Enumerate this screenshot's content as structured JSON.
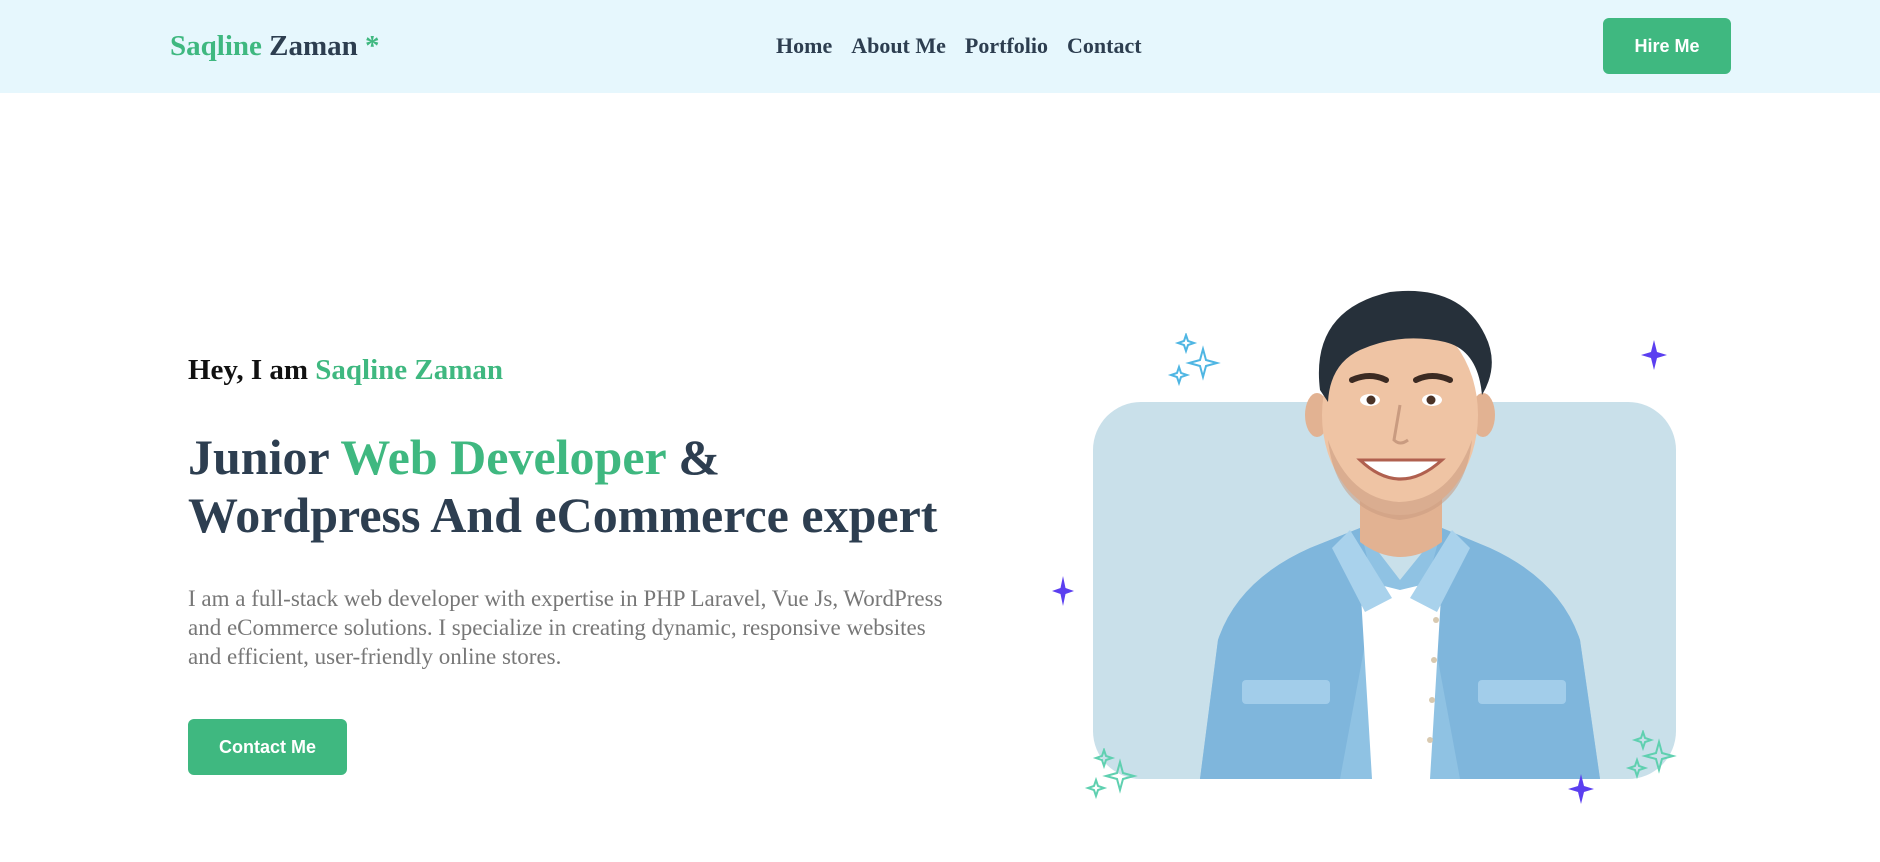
{
  "header": {
    "logo": {
      "first": "Saqline",
      "last": "Zaman",
      "mark": "*"
    },
    "nav": [
      {
        "label": "Home"
      },
      {
        "label": "About Me"
      },
      {
        "label": "Portfolio"
      },
      {
        "label": "Contact"
      }
    ],
    "cta_label": "Hire Me"
  },
  "hero": {
    "greeting_prefix": "Hey, I am",
    "greeting_name": "Saqline Zaman",
    "headline": {
      "part1": "Junior",
      "accent": "Web Developer",
      "part2": "&",
      "line2": "Wordpress And eCommerce expert"
    },
    "description": "I am a full-stack web developer with expertise in PHP Laravel, Vue Js, WordPress and eCommerce solutions. I specialize in creating dynamic, responsive websites and efficient, user-friendly online stores.",
    "cta_label": "Contact Me"
  },
  "colors": {
    "accent": "#3fb880",
    "header_bg": "#e6f7fd",
    "heading": "#2d3e50",
    "body_text": "#777777",
    "card_bg": "#c9e0ea",
    "spark_purple": "#5b3ff0",
    "spark_blue": "#4fb6e3",
    "spark_teal": "#5fd0b0"
  },
  "icons": {
    "sparkle_large": "four-point-star-icon",
    "sparkle_outline": "sparkle-outline-icon"
  }
}
